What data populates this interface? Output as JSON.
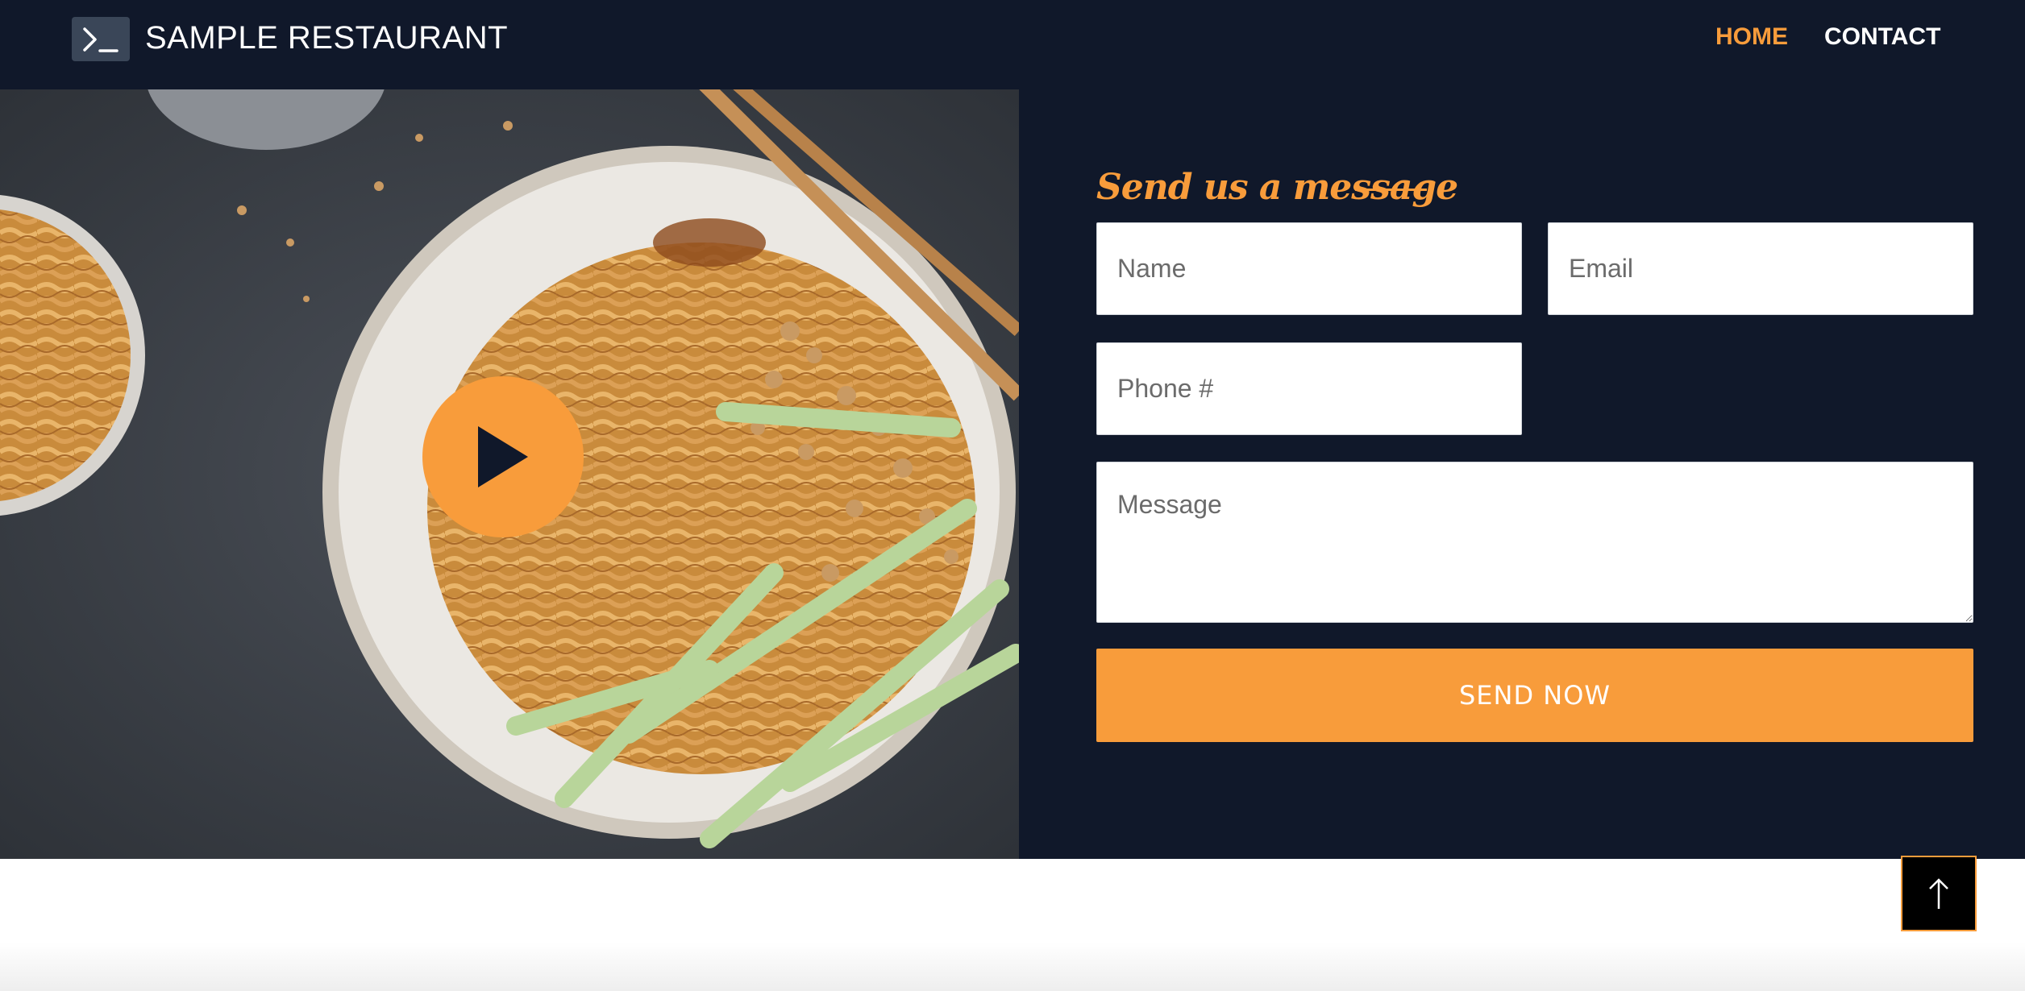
{
  "navbar": {
    "brand": "SAMPLE RESTAURANT",
    "logo_icon": "terminal-icon",
    "links": [
      {
        "label": "HOME",
        "active": true
      },
      {
        "label": "CONTACT",
        "active": false
      }
    ]
  },
  "hero": {
    "image": "noodle-bowl-photo",
    "play_icon": "play-icon"
  },
  "form": {
    "title": "Send us a message",
    "name_placeholder": "Name",
    "email_placeholder": "Email",
    "phone_placeholder": "Phone #",
    "message_placeholder": "Message",
    "submit_label": "SEND NOW"
  },
  "back_to_top_icon": "arrow-up-icon",
  "colors": {
    "background": "#10182a",
    "accent": "#f89c3b",
    "text": "#ffffff"
  }
}
